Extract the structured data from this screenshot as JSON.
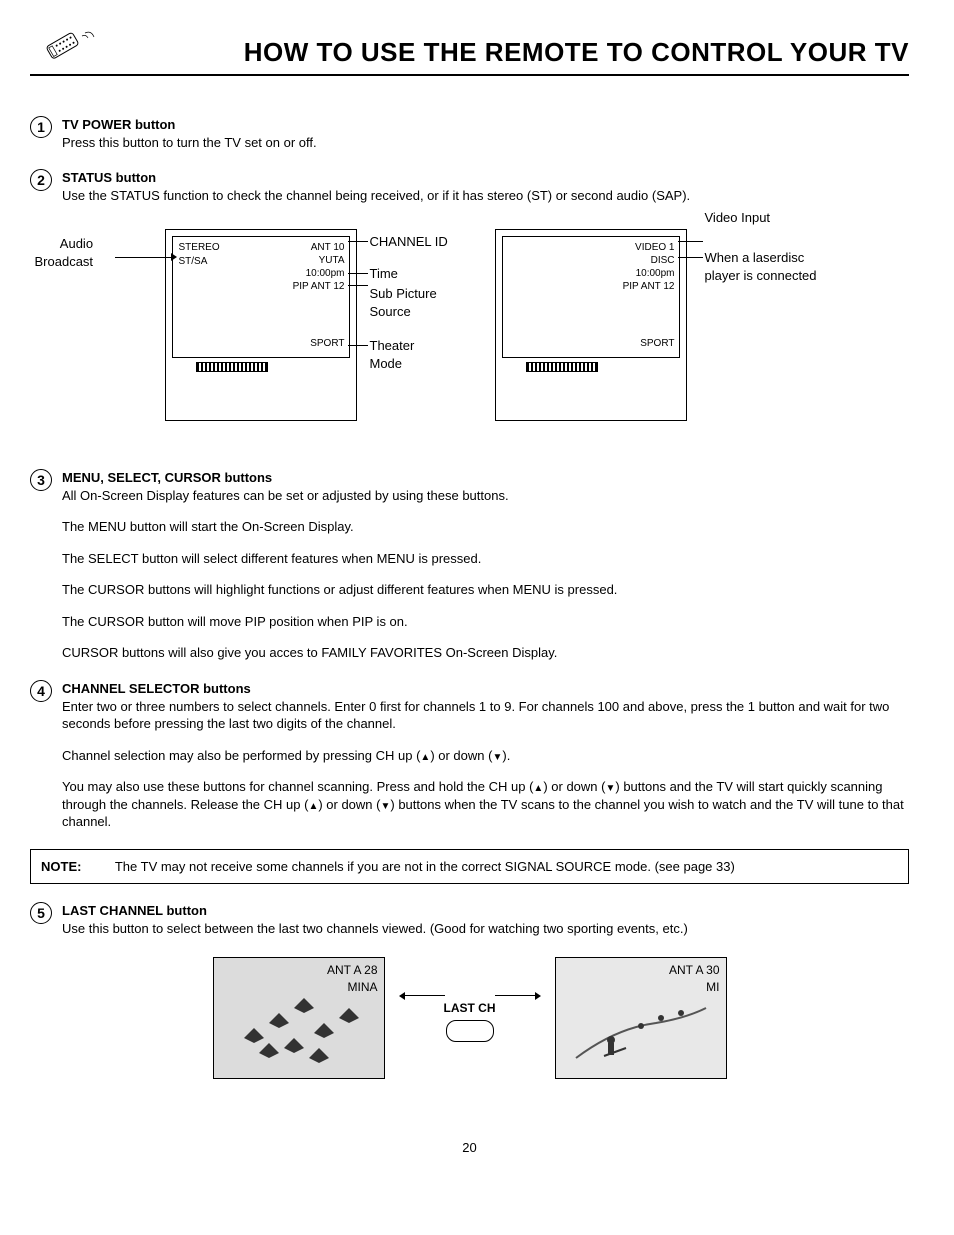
{
  "page_number": "20",
  "page_title": "HOW TO USE THE REMOTE TO CONTROL YOUR TV",
  "sections": {
    "s1": {
      "num": "1",
      "title": "TV POWER button",
      "desc": "Press this button to turn the TV set on or off."
    },
    "s2": {
      "num": "2",
      "title": "STATUS button",
      "desc": "Use the STATUS function to check the channel being received, or if it has stereo (ST) or second audio (SAP)."
    },
    "s3": {
      "num": "3",
      "title": "MENU, SELECT, CURSOR buttons",
      "desc": "All On-Screen Display features can be set or adjusted by using these buttons.",
      "p1": "The MENU button will start the On-Screen Display.",
      "p2": "The SELECT button will select different features when MENU is pressed.",
      "p3": "The CURSOR buttons will highlight functions or adjust different features when MENU is pressed.",
      "p4": "The CURSOR button will move PIP position when PIP is on.",
      "p5": "CURSOR buttons will also give you acces to FAMILY FAVORITES On-Screen Display."
    },
    "s4": {
      "num": "4",
      "title": "CHANNEL SELECTOR buttons",
      "desc": "Enter two or three numbers to select channels.  Enter  0  first for channels 1 to 9.  For channels 100 and above, press the  1  button and wait for two seconds before pressing the last two digits of the channel.",
      "p1_pre": "Channel selection may also be performed by pressing CH up (",
      "p1_mid": ") or down (",
      "p1_post": ").",
      "p2_a": "You may also use these buttons for channel scanning.  Press and hold the CH up (",
      "p2_b": ") or down (",
      "p2_c": ") buttons and the TV will start quickly scanning through the channels.  Release the CH up (",
      "p2_d": ") or down (",
      "p2_e": ") buttons when the TV scans to the channel you wish to watch and the TV will tune to that channel."
    },
    "s5": {
      "num": "5",
      "title": "LAST CHANNEL button",
      "desc": "Use this button to select between the last two channels viewed.  (Good for watching two sporting events, etc.)"
    }
  },
  "note": {
    "label": "NOTE:",
    "text": "The TV may not receive some channels if you are not in the correct SIGNAL SOURCE mode.  (see page 33)"
  },
  "diagram_left": {
    "label_left1": "Audio",
    "label_left2": "Broadcast",
    "osd1": "STEREO",
    "osd2": "ST/SA",
    "osd3": "ANT 10",
    "osd4": "YUTA",
    "osd5": "10:00pm",
    "osd6": "PIP ANT 12",
    "osd7": "SPORT",
    "lbl_r1": "CHANNEL ID",
    "lbl_r2": "Time",
    "lbl_r3": "Sub Picture",
    "lbl_r3b": "Source",
    "lbl_r4": "Theater",
    "lbl_r4b": "Mode"
  },
  "diagram_right": {
    "label_r1": "Video Input",
    "label_r2a": "When a laserdisc",
    "label_r2b": "player is connected",
    "osd1": "VIDEO 1",
    "osd2": "DISC",
    "osd3": "10:00pm",
    "osd4": "PIP ANT 12",
    "osd5": "SPORT"
  },
  "lastch": {
    "tv1_line1": "ANT A 28",
    "tv1_line2": "MINA",
    "tv2_line1": "ANT A 30",
    "tv2_line2": "MI",
    "btn_label": "LAST CH"
  },
  "arrows": {
    "up": "▲",
    "down": "▼"
  }
}
